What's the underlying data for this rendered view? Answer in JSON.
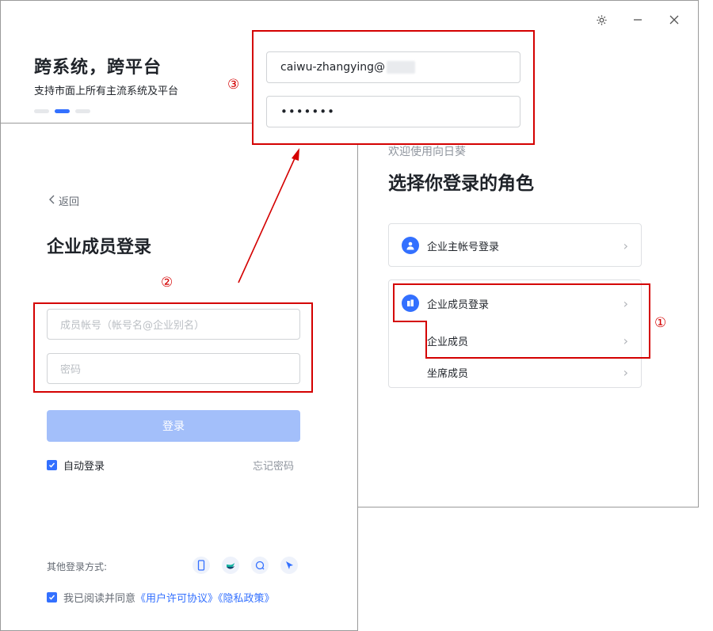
{
  "window": {
    "settings_icon": "gear-icon",
    "minimize_icon": "minus-icon",
    "close_icon": "close-icon"
  },
  "slogan": {
    "title": "跨系统，跨平台",
    "subtitle": "支持市面上所有主流系统及平台"
  },
  "role_panel": {
    "welcome": "欢迎使用向日葵",
    "title": "选择你登录的角色",
    "owner_login": "企业主帐号登录",
    "member_login": "企业成员登录",
    "member": "企业成员",
    "seat_member": "坐席成员"
  },
  "login": {
    "back": "返回",
    "title": "企业成员登录",
    "account_placeholder": "成员帐号（帐号名@企业别名）",
    "password_placeholder": "密码",
    "login_button": "登录",
    "auto_login": "自动登录",
    "forgot_password": "忘记密码",
    "other_methods": "其他登录方式:",
    "agree_prefix": "我已阅读并同意",
    "license_link": "《用户许可协议》",
    "privacy_link": "《隐私政策》"
  },
  "credentials": {
    "username": "caiwu-zhangying@",
    "password": "•••••••"
  },
  "annotations": {
    "step1": "①",
    "step2": "②",
    "step3": "③"
  },
  "colors": {
    "accent": "#3370ff",
    "annotation": "#d40000",
    "login_button_disabled": "#a3bffa"
  }
}
